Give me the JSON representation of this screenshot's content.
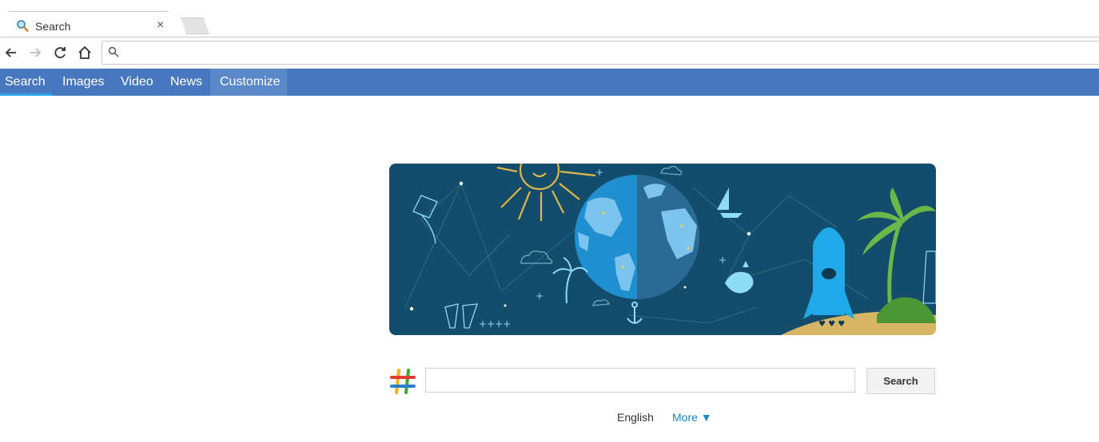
{
  "browser": {
    "tab": {
      "title": "Search",
      "icon": "magnifier-icon",
      "close": "×"
    },
    "omnibox": {
      "value": "",
      "placeholder": ""
    },
    "icons": [
      "back-icon",
      "forward-icon",
      "reload-icon",
      "home-icon",
      "search-icon"
    ]
  },
  "navbar": {
    "items": [
      {
        "label": "Search"
      },
      {
        "label": "Images"
      },
      {
        "label": "Video"
      },
      {
        "label": "News"
      },
      {
        "label": "Customize"
      }
    ],
    "color": "#4778bf",
    "active_color": "#29a6e6"
  },
  "search": {
    "query": "",
    "button_label": "Search"
  },
  "footer": {
    "language": "English",
    "more_label": "More ▼"
  },
  "colors": {
    "banner_bg": "#134d6b",
    "link": "#1a88c9"
  }
}
